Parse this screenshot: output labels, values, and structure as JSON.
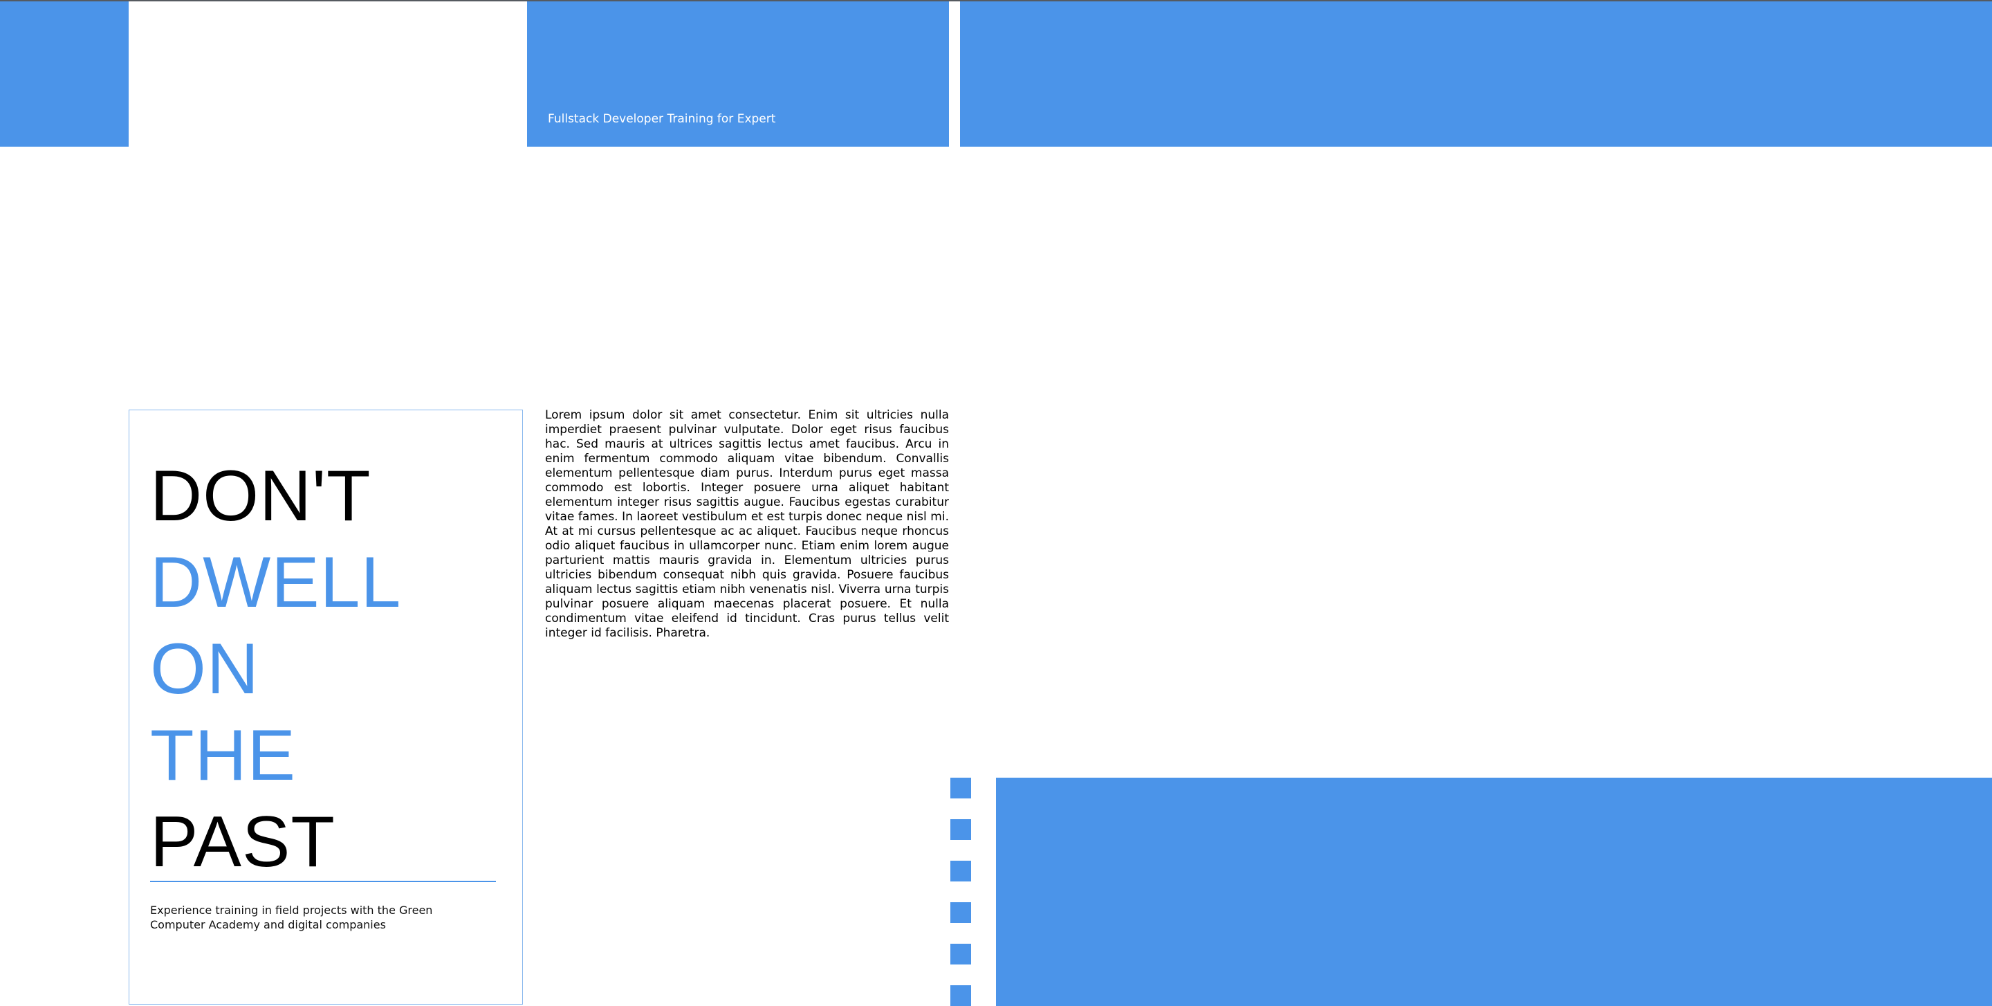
{
  "banner": {
    "tagline": "Fullstack Developer Training for Expert"
  },
  "card": {
    "headline_lines": [
      {
        "text": "DON'T",
        "tone": "dark"
      },
      {
        "text": "DWELL",
        "tone": "accent"
      },
      {
        "text": "ON",
        "tone": "accent"
      },
      {
        "text": "THE",
        "tone": "accent"
      },
      {
        "text": "PAST",
        "tone": "dark"
      }
    ],
    "caption": "Experience training in field projects with the Green Computer Academy and digital companies"
  },
  "body": {
    "paragraph": "Lorem ipsum dolor sit amet consectetur. Enim sit ultricies nulla imperdiet praesent pulvinar vulputate. Dolor eget risus faucibus hac. Sed mauris at ultrices sagittis lectus amet faucibus. Arcu in enim fermentum commodo aliquam vitae bibendum. Convallis elementum pellentesque diam purus. Interdum purus eget massa commodo est lobortis. Integer posuere urna aliquet habitant elementum integer risus sagittis augue. Faucibus egestas curabitur vitae fames. In laoreet vestibulum et est turpis donec neque nisl mi. At at mi cursus pellentesque ac ac aliquet. Faucibus neque rhoncus odio aliquet faucibus in ullamcorper nunc. Etiam enim lorem augue parturient mattis mauris gravida in. Elementum ultricies purus ultricies bibendum consequat nibh quis gravida. Posuere faucibus aliquam lectus sagittis etiam nibh venenatis nisl. Viverra urna turpis pulvinar posuere aliquam maecenas placerat posuere. Et nulla condimentum vitae eleifend id tincidunt. Cras purus tellus velit integer id facilisis. Pharetra."
  },
  "colors": {
    "accent": "#4b94e9",
    "text": "#000000",
    "background": "#ffffff"
  }
}
